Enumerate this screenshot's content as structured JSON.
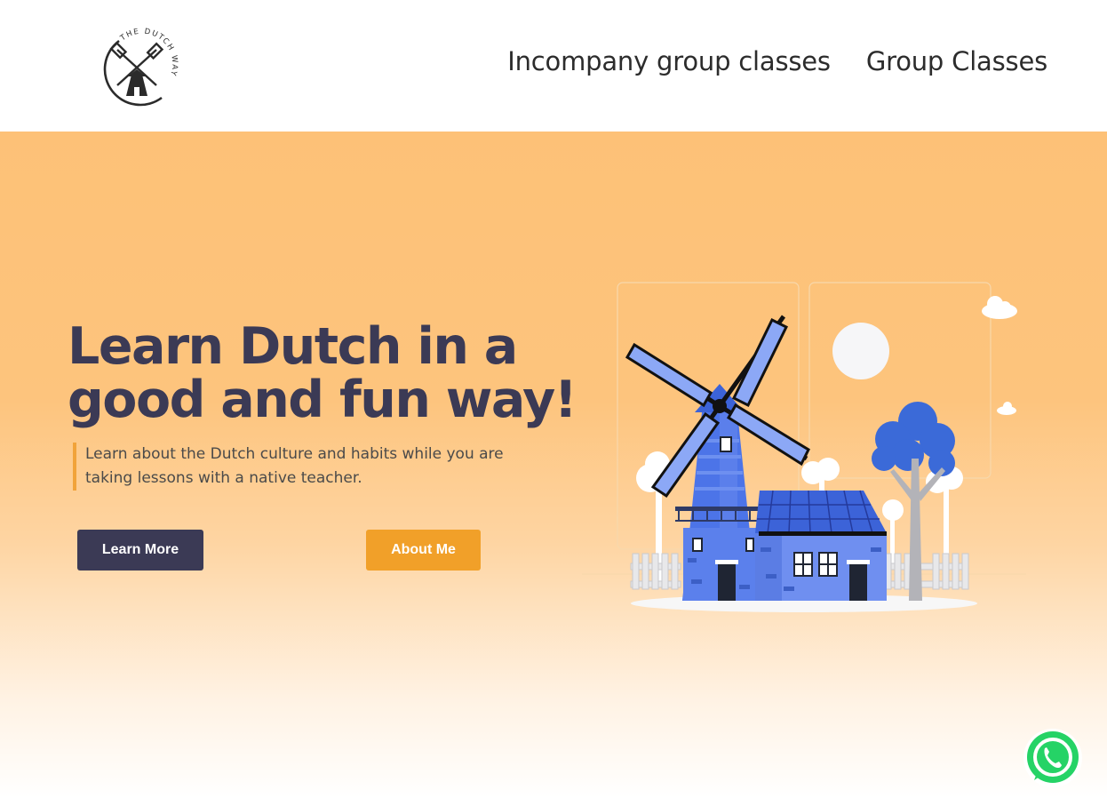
{
  "header": {
    "logo_text": "THE DUTCH WAY",
    "nav": [
      {
        "label": "Incompany group classes"
      },
      {
        "label": "Group Classes"
      }
    ]
  },
  "hero": {
    "title_line1": "Learn Dutch in a",
    "title_line2": "good and fun way!",
    "subtitle_line1": "Learn about the Dutch culture and habits while you are",
    "subtitle_line2": "taking lessons with a native teacher.",
    "learn_more_label": "Learn More",
    "about_me_label": "About Me"
  },
  "colors": {
    "hero_background": "#fdc177",
    "title_color": "#3b3a55",
    "accent_orange": "#f1a029",
    "windmill_blue": "#4c74e8",
    "whatsapp_green": "#25d366"
  },
  "floating": {
    "whatsapp_icon": "whatsapp-icon"
  }
}
